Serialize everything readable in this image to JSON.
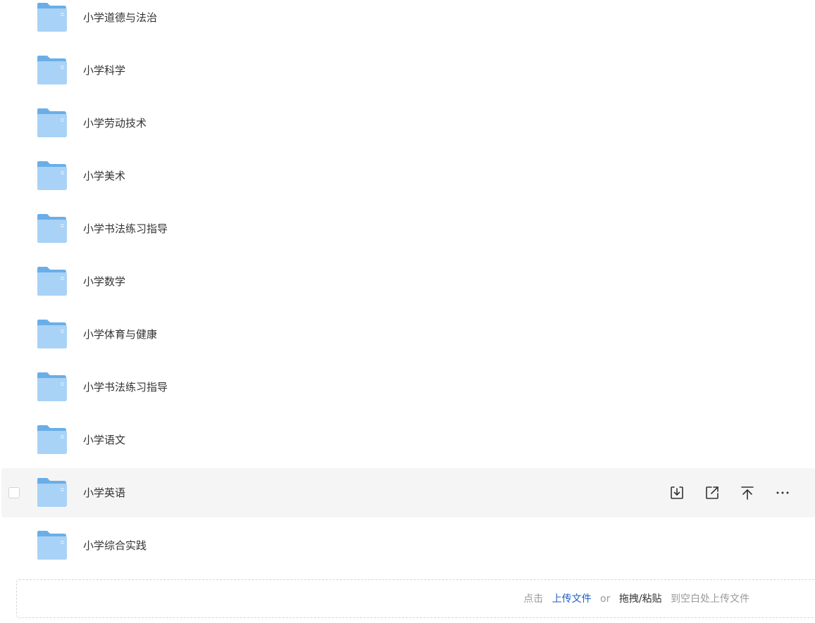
{
  "files": [
    {
      "name": "小学道德与法治",
      "type": "folder"
    },
    {
      "name": "小学科学",
      "type": "folder"
    },
    {
      "name": "小学劳动技术",
      "type": "folder"
    },
    {
      "name": "小学美术",
      "type": "folder"
    },
    {
      "name": "小学书法练习指导",
      "type": "folder"
    },
    {
      "name": "小学数学",
      "type": "folder"
    },
    {
      "name": "小学体育与健康",
      "type": "folder"
    },
    {
      "name": "小学书法练习指导",
      "type": "folder"
    },
    {
      "name": "小学语文",
      "type": "folder"
    },
    {
      "name": "小学英语",
      "type": "folder",
      "hovered": true
    },
    {
      "name": "小学综合实践",
      "type": "folder"
    }
  ],
  "row_actions": [
    {
      "icon": "download-icon",
      "action": "download"
    },
    {
      "icon": "share-icon",
      "action": "share"
    },
    {
      "icon": "move-top-icon",
      "action": "move-to-top"
    },
    {
      "icon": "more-icon",
      "action": "more"
    }
  ],
  "upload": {
    "prefix": "点击",
    "upload_link": "上传文件",
    "or_text": "or",
    "drag_paste": "拖拽/粘贴",
    "suffix": "到空白处上传文件"
  },
  "colors": {
    "folder_back": "#6aaee8",
    "folder_front": "#a9d2f7",
    "hover_bg": "#f5f5f6",
    "link": "#1f5fbf",
    "muted_text": "#999999"
  }
}
